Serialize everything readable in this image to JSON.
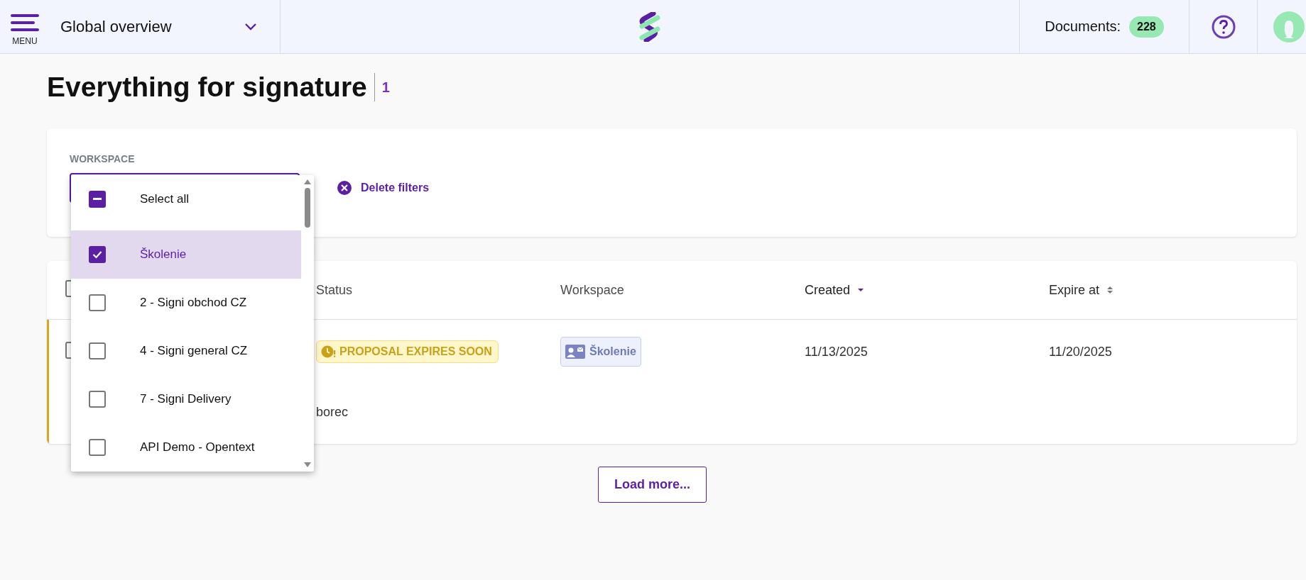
{
  "header": {
    "menu_label": "MENU",
    "view": "Global overview",
    "documents_label": "Documents:",
    "documents_count": "228"
  },
  "page": {
    "title": "Everything for signature",
    "count": "1"
  },
  "filters": {
    "label": "WORKSPACE",
    "delete_label": "Delete filters"
  },
  "workspace_dropdown": {
    "select_all": {
      "label": "Select all",
      "indeterminate": true
    },
    "options": [
      {
        "label": "Školenie",
        "checked": true,
        "selected": true
      },
      {
        "label": "2 - Signi obchod CZ",
        "checked": false,
        "selected": false
      },
      {
        "label": "4 - Signi general CZ",
        "checked": false,
        "selected": false
      },
      {
        "label": "7 - Signi Delivery",
        "checked": false,
        "selected": false
      },
      {
        "label": "API Demo - Opentext",
        "checked": false,
        "selected": false
      }
    ]
  },
  "table": {
    "header_checked": false,
    "columns": [
      {
        "label": "Status",
        "sortable": false,
        "sorted": false
      },
      {
        "label": "Workspace",
        "sortable": false,
        "sorted": false
      },
      {
        "label": "Created",
        "sortable": true,
        "sorted": true
      },
      {
        "label": "Expire at",
        "sortable": true,
        "sorted": false
      }
    ],
    "rows": [
      {
        "checked": false,
        "status": "PROPOSAL EXPIRES SOON",
        "workspace": "Školenie",
        "created": "11/13/2025",
        "expire_at": "11/20/2025",
        "detail": "borec"
      }
    ]
  },
  "load_more": "Load more..."
}
